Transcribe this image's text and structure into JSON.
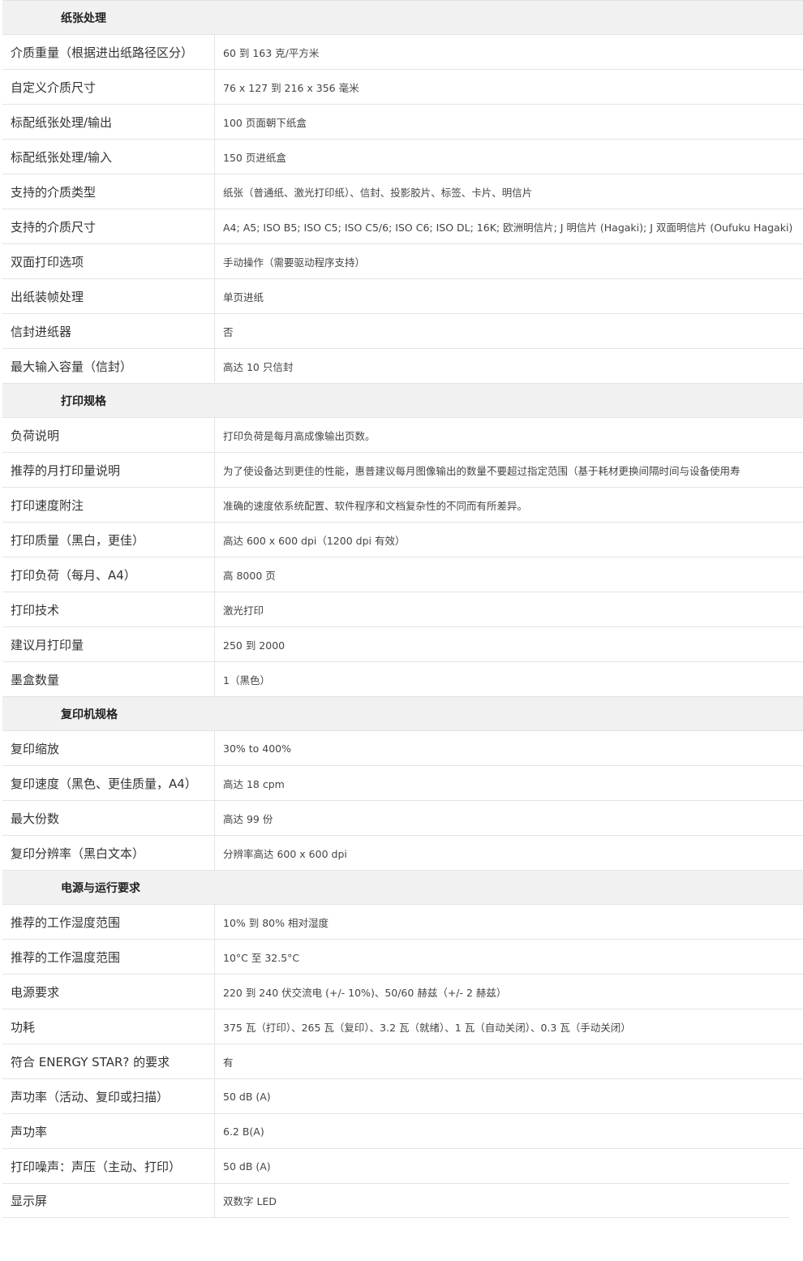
{
  "sections": [
    {
      "title": "纸张处理",
      "rows": [
        {
          "label": "介质重量（根据进出纸路径区分）",
          "value": "60 到 163 克/平方米"
        },
        {
          "label": "自定义介质尺寸",
          "value": "76 x 127 到 216 x 356 毫米"
        },
        {
          "label": "标配纸张处理/输出",
          "value": "100 页面朝下纸盒"
        },
        {
          "label": "标配纸张处理/输入",
          "value": "150 页进纸盒"
        },
        {
          "label": "支持的介质类型",
          "value": "纸张（普通纸、激光打印纸）、信封、投影胶片、标签、卡片、明信片"
        },
        {
          "label": "支持的介质尺寸",
          "value": "A4; A5; ISO B5; ISO C5; ISO C5/6; ISO C6; ISO DL; 16K; 欧洲明信片; J 明信片 (Hagaki); J 双面明信片 (Oufuku Hagaki)"
        },
        {
          "label": "双面打印选项",
          "value": "手动操作（需要驱动程序支持）"
        },
        {
          "label": "出纸装帧处理",
          "value": "单页进纸"
        },
        {
          "label": "信封进纸器",
          "value": "否"
        },
        {
          "label": "最大输入容量（信封）",
          "value": "高达 10 只信封"
        }
      ]
    },
    {
      "title": "打印规格",
      "rows": [
        {
          "label": "负荷说明",
          "value": "打印负荷是每月高成像输出页数。"
        },
        {
          "label": "推荐的月打印量说明",
          "value": "为了使设备达到更佳的性能，惠普建议每月图像输出的数量不要超过指定范围（基于耗材更换间隔时间与设备使用寿"
        },
        {
          "label": "打印速度附注",
          "value": "准确的速度依系统配置、软件程序和文档复杂性的不同而有所差异。"
        },
        {
          "label": "打印质量（黑白，更佳）",
          "value": "高达 600 x 600 dpi（1200 dpi 有效）"
        },
        {
          "label": "打印负荷（每月、A4）",
          "value": "高 8000 页"
        },
        {
          "label": "打印技术",
          "value": "激光打印"
        },
        {
          "label": "建议月打印量",
          "value": "250 到 2000"
        },
        {
          "label": "墨盒数量",
          "value": "1（黑色）"
        }
      ]
    },
    {
      "title": "复印机规格",
      "rows": [
        {
          "label": "复印缩放",
          "value": "30% to 400%"
        },
        {
          "label": "复印速度（黑色、更佳质量，A4）",
          "value": "高达 18 cpm"
        },
        {
          "label": "最大份数",
          "value": "高达 99 份"
        },
        {
          "label": "复印分辨率（黑白文本）",
          "value": "分辨率高达 600 x 600 dpi"
        }
      ]
    },
    {
      "title": "电源与运行要求",
      "rows": [
        {
          "label": "推荐的工作湿度范围",
          "value": "10% 到 80% 相对湿度"
        },
        {
          "label": "推荐的工作温度范围",
          "value": "10°C 至 32.5°C"
        },
        {
          "label": "电源要求",
          "value": "220 到 240 伏交流电 (+/- 10%)、50/60 赫兹（+/- 2 赫兹）"
        },
        {
          "label": "功耗",
          "value": "375 瓦（打印）、265 瓦（复印）、3.2 瓦（就绪）、1 瓦（自动关闭）、0.3 瓦（手动关闭）"
        },
        {
          "label": "符合 ENERGY STAR? 的要求",
          "value": "有"
        },
        {
          "label": "声功率（活动、复印或扫描）",
          "value": "50 dB (A)"
        },
        {
          "label": "声功率",
          "value": "6.2 B(A)"
        },
        {
          "label": "打印噪声：声压（主动、打印）",
          "value": "50 dB (A)"
        },
        {
          "label": "显示屏",
          "value": "双数字 LED"
        }
      ]
    }
  ]
}
